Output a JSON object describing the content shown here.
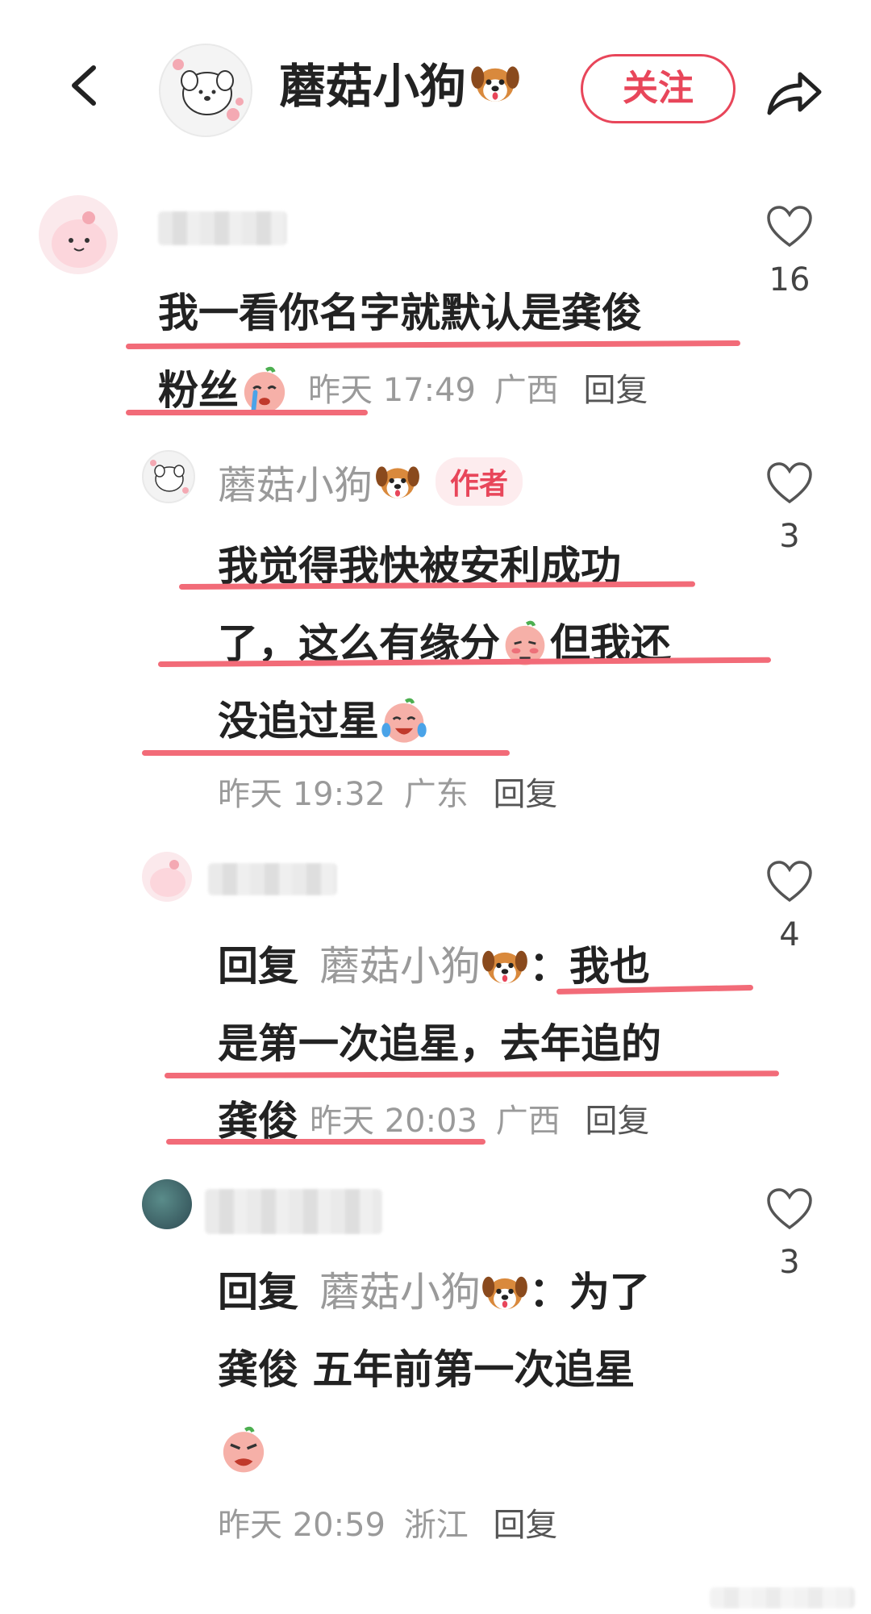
{
  "header": {
    "title": "蘑菇小狗",
    "follow_label": "关注"
  },
  "comments": [
    {
      "text_line1": "我一看你名字就默认是龚俊",
      "text_line2": "粉丝",
      "time": "昨天 17:49",
      "region": "广西",
      "reply_label": "回复",
      "likes": "16"
    },
    {
      "author": "蘑菇小狗",
      "badge": "作者",
      "text_line1": "我觉得我快被安利成功",
      "text_line2a": "了，这么有缘分",
      "text_line2b": "但我还",
      "text_line3": "没追过星",
      "time": "昨天 19:32",
      "region": "广东",
      "reply_label": "回复",
      "likes": "3"
    },
    {
      "reply_prefix": "回复",
      "reply_target": "蘑菇小狗",
      "text_line1": "：我也",
      "text_line2": "是第一次追星，去年追的",
      "text_line3": "龚俊",
      "time": "昨天 20:03",
      "region": "广西",
      "reply_label": "回复",
      "likes": "4"
    },
    {
      "reply_prefix": "回复",
      "reply_target": "蘑菇小狗",
      "text_line1": "：为了",
      "text_line2": "龚俊 五年前第一次追星",
      "time": "昨天 20:59",
      "region": "浙江",
      "reply_label": "回复",
      "likes": "3"
    }
  ],
  "colors": {
    "accent": "#e8465a",
    "underline": "#f26b78",
    "meta_gray": "#9a9a9a"
  },
  "icons": [
    "chevron-left-icon",
    "share-arrow-icon",
    "heart-outline-icon",
    "dog-emoji-icon",
    "crying-face-icon",
    "blushing-face-icon",
    "laughing-tears-icon",
    "angry-face-icon"
  ]
}
